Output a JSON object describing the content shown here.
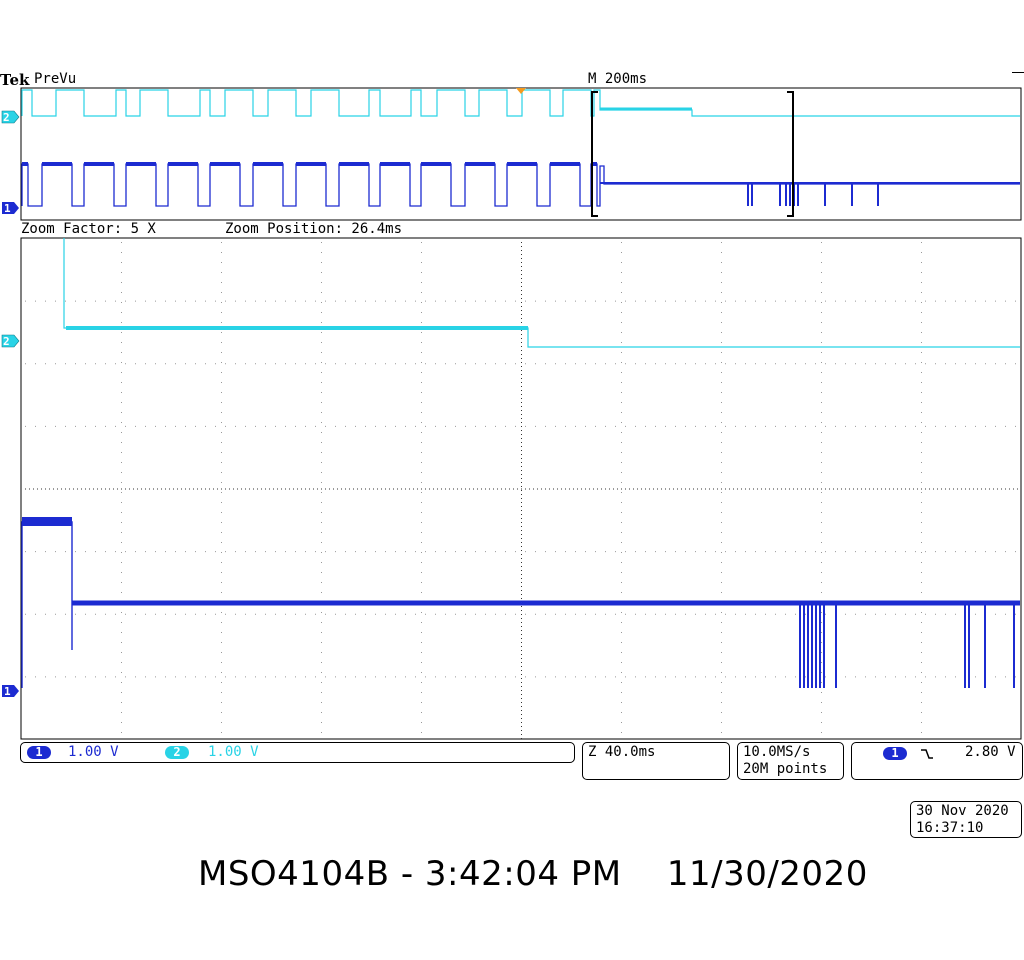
{
  "header": {
    "brand": "Tek",
    "mode": "PreVu",
    "timebase": "M 200ms"
  },
  "zoom": {
    "factor_label": "Zoom Factor: 5 X",
    "position_label": "Zoom Position: 26.4ms"
  },
  "channels": [
    {
      "id": "1",
      "scale": "1.00 V",
      "color": "#1c2bd1"
    },
    {
      "id": "2",
      "scale": "1.00 V",
      "color": "#29d3e6"
    }
  ],
  "zoom_timebase": "Z 40.0ms",
  "acquisition": {
    "rate": "10.0MS/s",
    "points": "20M points"
  },
  "trigger": {
    "source": "1",
    "slope_icon": "falling-edge-icon",
    "level": "2.80 V"
  },
  "datetime": {
    "date": "30 Nov 2020",
    "time": "16:37:10"
  },
  "caption": "MSO4104B - 3:42:04 PM    11/30/2020"
}
